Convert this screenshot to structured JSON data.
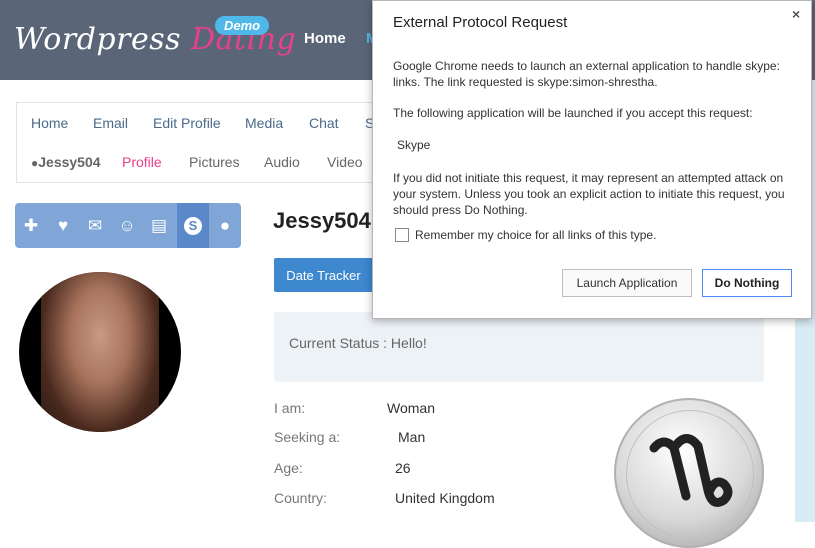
{
  "header": {
    "logo_word1": "Wordpress",
    "logo_word2": "Dating",
    "demo_badge": "Demo",
    "nav_home": "Home",
    "nav_partial": "M"
  },
  "menu": {
    "primary": [
      "Home",
      "Email",
      "Edit Profile",
      "Media",
      "Chat",
      "Se"
    ],
    "secondary_user": "Jessy504",
    "secondary": [
      "Profile",
      "Pictures",
      "Audio",
      "Video"
    ]
  },
  "icon_bar": {
    "icons": [
      "plus-icon",
      "heart-icon",
      "mail-icon",
      "smiley-icon",
      "gift-icon",
      "skype-icon",
      "chat-bubble-icon"
    ],
    "active": "skype-icon"
  },
  "profile": {
    "username": "Jessy504",
    "date_tracker_label": "Date Tracker",
    "status": "Current Status : Hello!",
    "fields": [
      {
        "label": "I am:",
        "value": "Woman"
      },
      {
        "label": "Seeking a:",
        "value": "Man"
      },
      {
        "label": "Age:",
        "value": "26"
      },
      {
        "label": "Country:",
        "value": "United Kingdom"
      }
    ],
    "zodiac_icon": "capricorn-icon"
  },
  "dialog": {
    "title": "External Protocol Request",
    "close": "×",
    "message1": "Google Chrome needs to launch an external application to handle skype: links. The link requested is skype:simon-shrestha.",
    "message2": "The following application will be launched if you accept this request:",
    "application": "Skype",
    "message3": "If you did not initiate this request, it may represent an attempted attack on your system. Unless you took an explicit action to initiate this request, you should press Do Nothing.",
    "checkbox_label": "Remember my choice for all links of this type.",
    "launch_button": "Launch Application",
    "nothing_button": "Do Nothing"
  },
  "colors": {
    "header_bg": "#5a6577",
    "brand_pink": "#e8408a",
    "accent_blue": "#3e88d0",
    "icon_bar": "#7fa6d6"
  }
}
